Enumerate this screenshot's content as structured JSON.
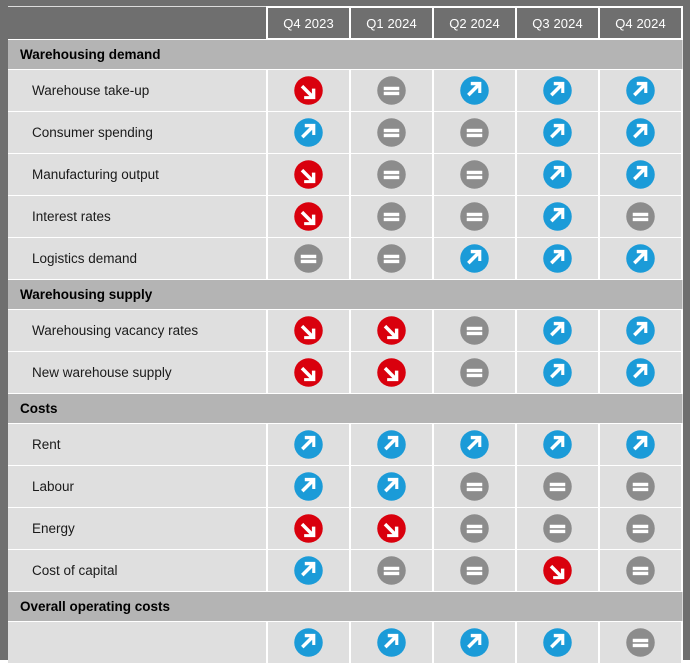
{
  "table": {
    "columns": [
      "Q4 2023",
      "Q1 2024",
      "Q2 2024",
      "Q3 2024",
      "Q4 2024"
    ],
    "corner_label": "",
    "colors": {
      "up": "#1b9bd8",
      "down": "#d9000d",
      "flat": "#8c8c8c",
      "frame": "#6f6f6f",
      "section_bg": "#b4b4b4",
      "row_bg": "#dfdfdf",
      "header_bg": "#6f6f6f"
    },
    "icon_names": {
      "up": "arrow-up-right-icon",
      "down": "arrow-down-right-icon",
      "flat": "equals-icon"
    },
    "sections": [
      {
        "title": "Warehousing demand",
        "rows": [
          {
            "label": "Warehouse take-up",
            "values": [
              "down",
              "flat",
              "up",
              "up",
              "up"
            ]
          },
          {
            "label": "Consumer spending",
            "values": [
              "up",
              "flat",
              "flat",
              "up",
              "up"
            ]
          },
          {
            "label": "Manufacturing output",
            "values": [
              "down",
              "flat",
              "flat",
              "up",
              "up"
            ]
          },
          {
            "label": "Interest rates",
            "values": [
              "down",
              "flat",
              "flat",
              "up",
              "flat"
            ]
          },
          {
            "label": "Logistics demand",
            "values": [
              "flat",
              "flat",
              "up",
              "up",
              "up"
            ]
          }
        ]
      },
      {
        "title": "Warehousing supply",
        "rows": [
          {
            "label": "Warehousing vacancy rates",
            "values": [
              "down",
              "down",
              "flat",
              "up",
              "up"
            ]
          },
          {
            "label": "New warehouse supply",
            "values": [
              "down",
              "down",
              "flat",
              "up",
              "up"
            ]
          }
        ]
      },
      {
        "title": "Costs",
        "rows": [
          {
            "label": "Rent",
            "values": [
              "up",
              "up",
              "up",
              "up",
              "up"
            ]
          },
          {
            "label": "Labour",
            "values": [
              "up",
              "up",
              "flat",
              "flat",
              "flat"
            ]
          },
          {
            "label": "Energy",
            "values": [
              "down",
              "down",
              "flat",
              "flat",
              "flat"
            ]
          },
          {
            "label": "Cost of capital",
            "values": [
              "up",
              "flat",
              "flat",
              "down",
              "flat"
            ]
          }
        ]
      },
      {
        "title": "Overall operating costs",
        "rows": [
          {
            "label": "",
            "values": [
              "up",
              "up",
              "up",
              "up",
              "flat"
            ]
          }
        ]
      }
    ]
  }
}
